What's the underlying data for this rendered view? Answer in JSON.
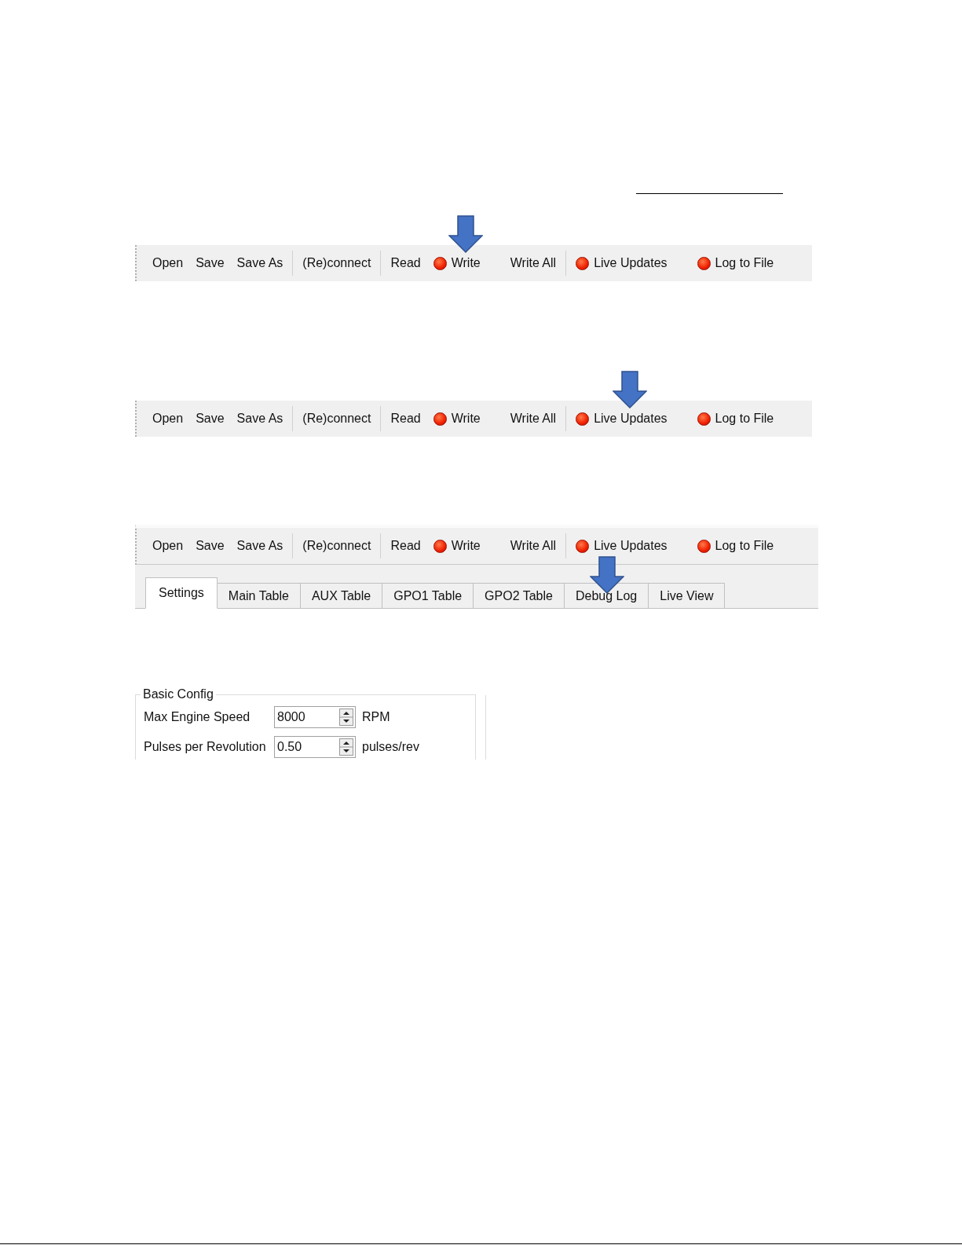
{
  "figures": [
    {
      "toolbar": [
        {
          "items": [
            {
              "kind": "button",
              "label": "Open",
              "pointed": false
            },
            {
              "kind": "button",
              "label": "Save",
              "pointed": false
            },
            {
              "kind": "button",
              "label": "Save As",
              "pointed": false
            }
          ]
        },
        {
          "items": [
            {
              "kind": "button",
              "label": "(Re)connect",
              "pointed": false
            }
          ]
        },
        {
          "items": [
            {
              "kind": "button",
              "label": "Read",
              "pointed": false
            },
            {
              "kind": "led",
              "label": "Write",
              "pointed": true
            },
            {
              "kind": "button",
              "label": "Write All",
              "pointed": false
            }
          ]
        },
        {
          "items": [
            {
              "kind": "led",
              "label": "Live Updates",
              "pointed": false
            },
            {
              "kind": "led",
              "label": "Log to File",
              "pointed": false
            }
          ]
        }
      ]
    },
    {
      "toolbar": [
        {
          "items": [
            {
              "kind": "button",
              "label": "Open",
              "pointed": false
            },
            {
              "kind": "button",
              "label": "Save",
              "pointed": false
            },
            {
              "kind": "button",
              "label": "Save As",
              "pointed": false
            }
          ]
        },
        {
          "items": [
            {
              "kind": "button",
              "label": "(Re)connect",
              "pointed": false
            }
          ]
        },
        {
          "items": [
            {
              "kind": "button",
              "label": "Read",
              "pointed": false
            },
            {
              "kind": "led",
              "label": "Write",
              "pointed": false
            },
            {
              "kind": "button",
              "label": "Write All",
              "pointed": false
            }
          ]
        },
        {
          "items": [
            {
              "kind": "led",
              "label": "Live Updates",
              "pointed": true
            },
            {
              "kind": "led",
              "label": "Log to File",
              "pointed": false
            }
          ]
        }
      ]
    },
    {
      "toolbar": [
        {
          "items": [
            {
              "kind": "button",
              "label": "Open",
              "pointed": false
            },
            {
              "kind": "button",
              "label": "Save",
              "pointed": false
            },
            {
              "kind": "button",
              "label": "Save As",
              "pointed": false
            }
          ]
        },
        {
          "items": [
            {
              "kind": "button",
              "label": "(Re)connect",
              "pointed": false
            }
          ]
        },
        {
          "items": [
            {
              "kind": "button",
              "label": "Read",
              "pointed": false
            },
            {
              "kind": "led",
              "label": "Write",
              "pointed": false
            },
            {
              "kind": "button",
              "label": "Write All",
              "pointed": false
            }
          ]
        },
        {
          "items": [
            {
              "kind": "led",
              "label": "Live Updates",
              "pointed": false
            },
            {
              "kind": "led",
              "label": "Log to File",
              "pointed": false
            }
          ]
        }
      ],
      "tabs": [
        {
          "label": "Settings",
          "selected": true,
          "pointed": false
        },
        {
          "label": "Main Table",
          "selected": false,
          "pointed": false
        },
        {
          "label": "AUX Table",
          "selected": false,
          "pointed": false
        },
        {
          "label": "GPO1 Table",
          "selected": false,
          "pointed": false
        },
        {
          "label": "GPO2 Table",
          "selected": false,
          "pointed": false
        },
        {
          "label": "Debug Log",
          "selected": false,
          "pointed": true
        },
        {
          "label": "Live View",
          "selected": false,
          "pointed": false
        }
      ]
    }
  ],
  "group_box": {
    "title": "Basic Config",
    "rows": [
      {
        "label": "Max Engine Speed",
        "value": "8000",
        "unit": "RPM"
      },
      {
        "label": "Pulses per Revolution",
        "value": "0.50",
        "unit": "pulses/rev"
      }
    ]
  }
}
